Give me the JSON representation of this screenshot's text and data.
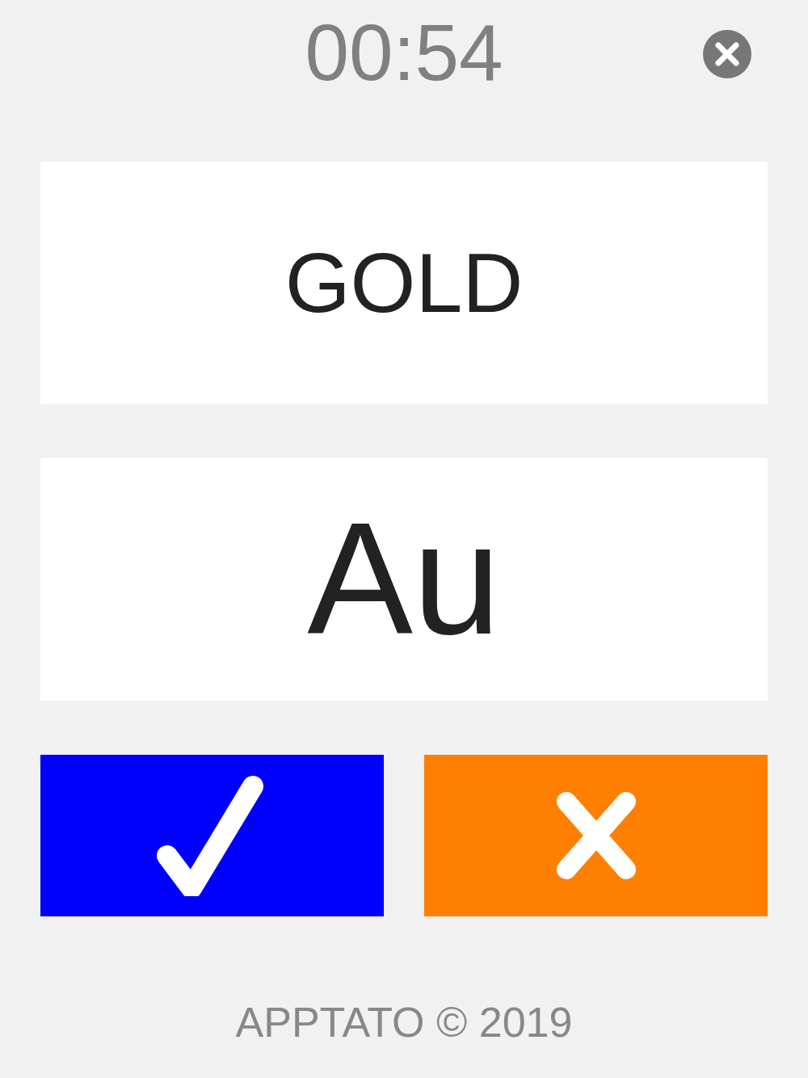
{
  "timer": "00:54",
  "close_button": {
    "kind": "close"
  },
  "cards": [
    {
      "text": "GOLD",
      "kind": "name"
    },
    {
      "text": "Au",
      "kind": "symbol"
    }
  ],
  "answer_buttons": [
    {
      "kind": "correct"
    },
    {
      "kind": "wrong"
    }
  ],
  "footer": "APPTATO © 2019"
}
